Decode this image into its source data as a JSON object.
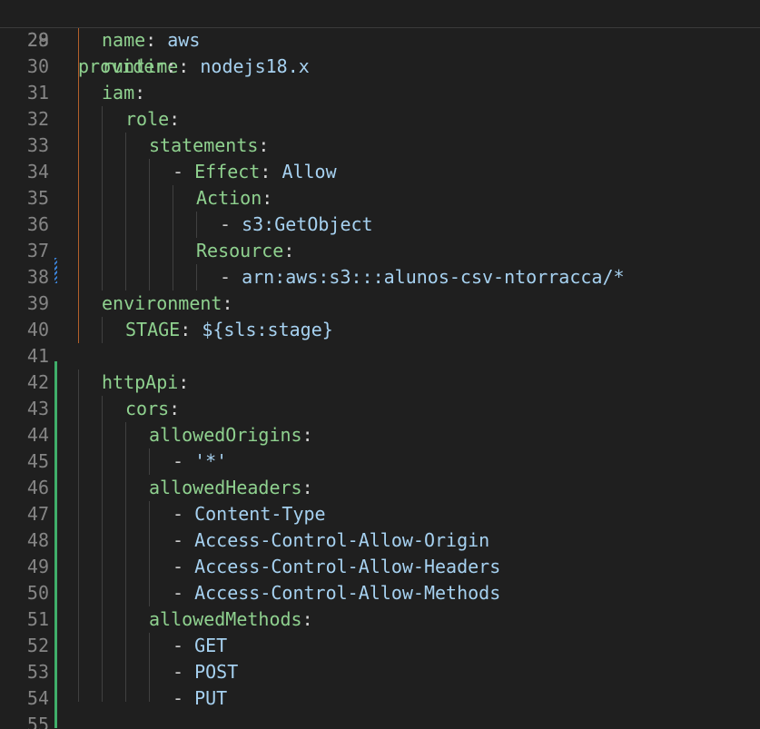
{
  "editor": {
    "language": "yaml",
    "sticky_scroll": {
      "line_number": "28",
      "key": "provider",
      "colon": ":"
    },
    "lines": [
      {
        "n": "29",
        "key": "name",
        "value": "aws"
      },
      {
        "n": "30",
        "key": "runtime",
        "value": "nodejs18.x"
      },
      {
        "n": "31",
        "key": "iam",
        "value": ""
      },
      {
        "n": "32",
        "key": "role",
        "value": ""
      },
      {
        "n": "33",
        "key": "statements",
        "value": ""
      },
      {
        "n": "34",
        "dash": "- ",
        "key": "Effect",
        "value": "Allow"
      },
      {
        "n": "35",
        "key": "Action",
        "value": ""
      },
      {
        "n": "36",
        "dash": "- ",
        "value": "s3:GetObject"
      },
      {
        "n": "37",
        "key": "Resource",
        "value": ""
      },
      {
        "n": "38",
        "dash": "- ",
        "value": "arn:aws:s3:::alunos-csv-ntorracca/*"
      },
      {
        "n": "39",
        "key": "environment",
        "value": ""
      },
      {
        "n": "40",
        "key": "STAGE",
        "value": "${sls:stage}"
      },
      {
        "n": "41"
      },
      {
        "n": "42",
        "key": "httpApi",
        "value": ""
      },
      {
        "n": "43",
        "key": "cors",
        "value": ""
      },
      {
        "n": "44",
        "key": "allowedOrigins",
        "value": ""
      },
      {
        "n": "45",
        "dash": "- ",
        "value": "'*'"
      },
      {
        "n": "46",
        "key": "allowedHeaders",
        "value": ""
      },
      {
        "n": "47",
        "dash": "- ",
        "value": "Content-Type"
      },
      {
        "n": "48",
        "dash": "- ",
        "value": "Access-Control-Allow-Origin"
      },
      {
        "n": "49",
        "dash": "- ",
        "value": "Access-Control-Allow-Headers"
      },
      {
        "n": "50",
        "dash": "- ",
        "value": "Access-Control-Allow-Methods"
      },
      {
        "n": "51",
        "key": "allowedMethods",
        "value": ""
      },
      {
        "n": "52",
        "dash": "- ",
        "value": "GET"
      },
      {
        "n": "53",
        "dash": "- ",
        "value": "POST"
      },
      {
        "n": "54",
        "dash": "- ",
        "value": "PUT"
      },
      {
        "n": "55"
      }
    ],
    "colors": {
      "background": "#1f1f1f",
      "line_number": "#858585",
      "key": "#8fd18f",
      "value": "#a6d1f0",
      "modified_gutter": "#3fae6a",
      "indent_guide_active": "#b4602a"
    }
  }
}
